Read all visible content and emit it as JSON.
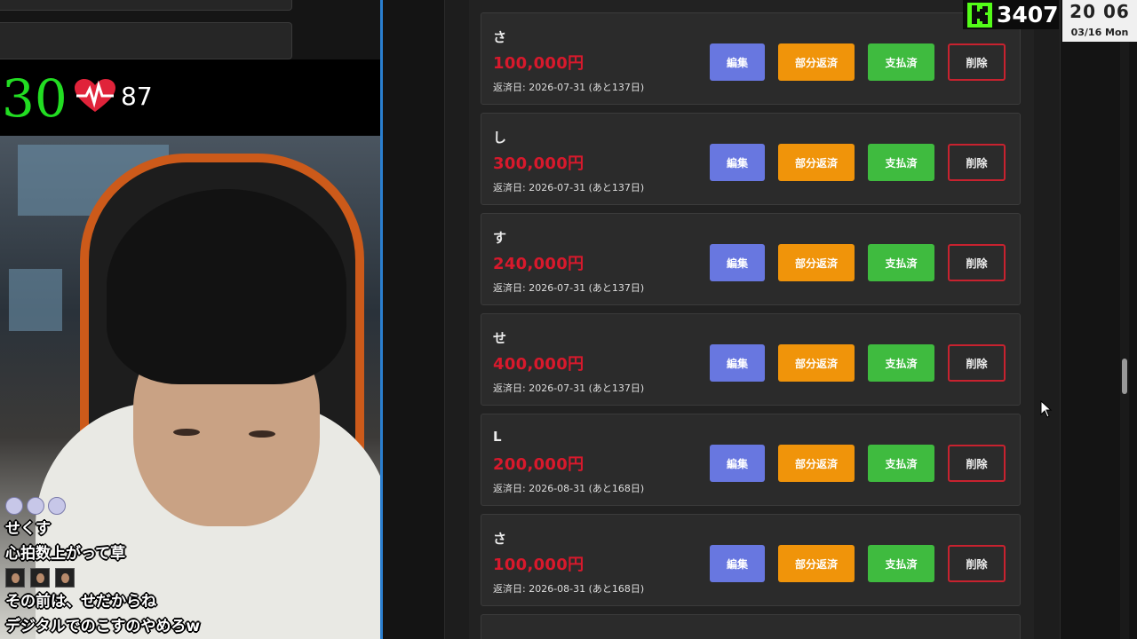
{
  "stream_overlay": {
    "fps_value": "30",
    "heart_rate_bpm": "87",
    "kick_viewer_count": "3407",
    "clock_time": "20 06",
    "clock_date": "03/16 Mon",
    "colors": {
      "kick_green": "#53fc18",
      "fps_green": "#22dd22"
    }
  },
  "chat": {
    "messages": [
      "せくす",
      "心拍数上がって草",
      "その前は、せだからね",
      "デジタルでのこすのやめろw"
    ]
  },
  "button_labels": {
    "edit": "編集",
    "partial_repay": "部分返済",
    "paid": "支払済",
    "delete": "削除"
  },
  "loans": [
    {
      "name": "さ",
      "amount": "100,000円",
      "due": "返済日: 2026-07-31 (あと137日)"
    },
    {
      "name": "し",
      "amount": "300,000円",
      "due": "返済日: 2026-07-31 (あと137日)"
    },
    {
      "name": "す",
      "amount": "240,000円",
      "due": "返済日: 2026-07-31 (あと137日)"
    },
    {
      "name": "せ",
      "amount": "400,000円",
      "due": "返済日: 2026-07-31 (あと137日)"
    },
    {
      "name": "L",
      "amount": "200,000円",
      "due": "返済日: 2026-08-31 (あと168日)"
    },
    {
      "name": "さ",
      "amount": "100,000円",
      "due": "返済日: 2026-08-31 (あと168日)"
    }
  ],
  "colors": {
    "amount_red": "#d8192c",
    "edit_blue": "#6877e0",
    "partial_orange": "#f0940a",
    "paid_green": "#3fbb3f",
    "delete_border": "#c8222f"
  }
}
